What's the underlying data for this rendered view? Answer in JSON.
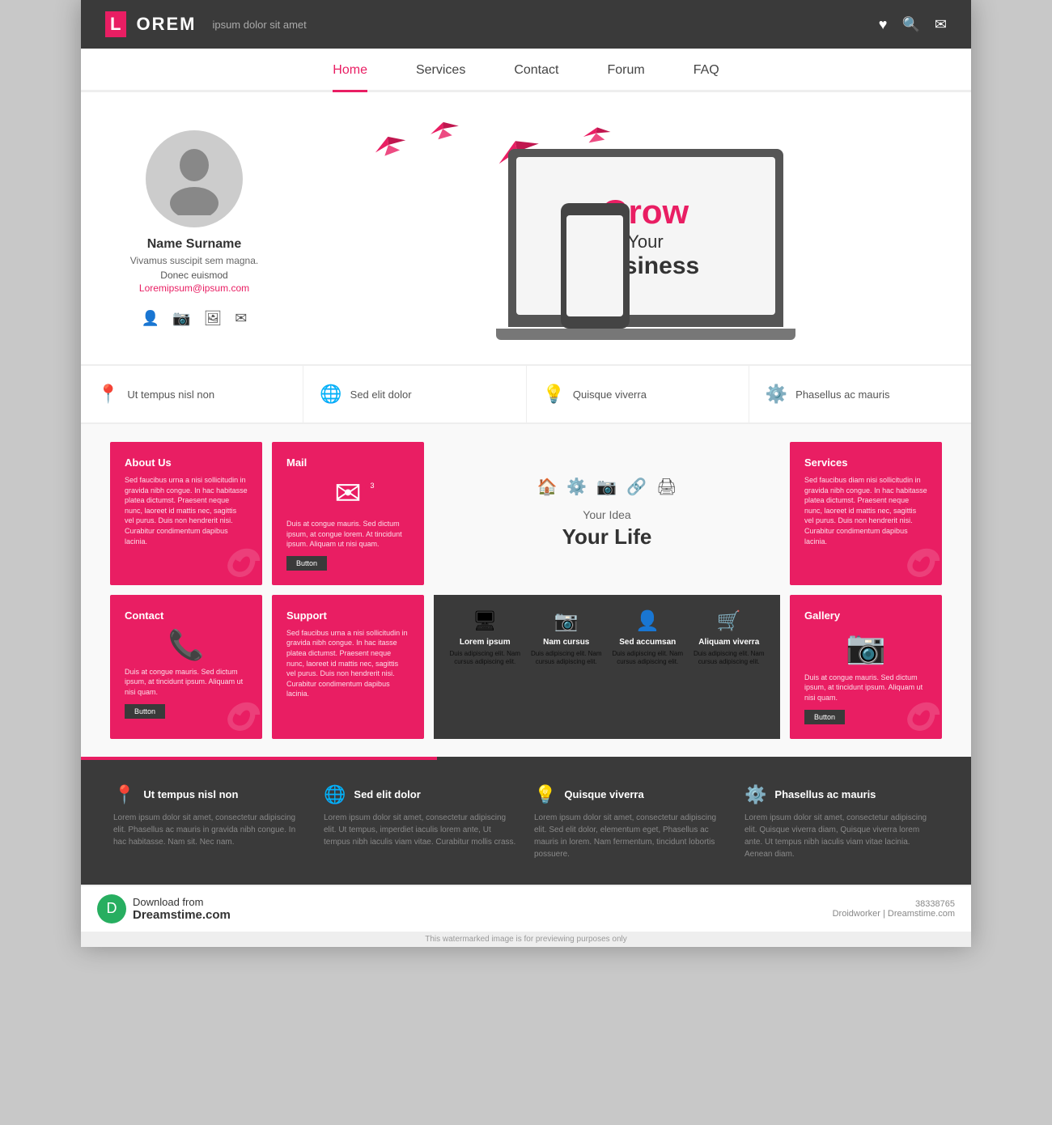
{
  "header": {
    "logo_accent": "L",
    "logo_rest": "OREM",
    "tagline": "ipsum dolor sit amet"
  },
  "nav": {
    "items": [
      {
        "label": "Home",
        "active": true
      },
      {
        "label": "Services",
        "active": false
      },
      {
        "label": "Contact",
        "active": false
      },
      {
        "label": "Forum",
        "active": false
      },
      {
        "label": "FAQ",
        "active": false
      }
    ]
  },
  "profile": {
    "name": "Name Surname",
    "desc": "Vivamus suscipit sem magna.",
    "sub": "Donec euismod",
    "email": "Loremipsum@ipsum.com"
  },
  "hero": {
    "grow": "Grow",
    "your": "Your",
    "business": "Business"
  },
  "features": [
    {
      "icon": "📍",
      "text": "Ut tempus nisl non"
    },
    {
      "icon": "🌐",
      "text": "Sed elit dolor"
    },
    {
      "icon": "💡",
      "text": "Quisque viverra"
    },
    {
      "icon": "⚙️",
      "text": "Phasellus ac mauris"
    }
  ],
  "cards": {
    "about": {
      "title": "About Us",
      "body": "Sed faucibus urna a nisi sollicitudin in gravida nibh congue. In hac habitasse platea dictumst. Praesent neque nunc, laoreet id mattis nec, sagittis vel purus. Duis non hendrerit nisi. Curabitur condimentum dapibus lacinia."
    },
    "mail": {
      "title": "Mail",
      "body": "Duis at congue mauris. Sed dictum ipsum, at congue lorem. At tincidunt ipsum. Aliquam ut nisi quam.",
      "badge": "3",
      "button": "Button"
    },
    "center": {
      "idea": "Your Idea",
      "life": "Your Life"
    },
    "services_card": {
      "title": "Services",
      "body": "Sed faucibus diam nisi sollicitudin in gravida nibh congue. In hac habitasse platea dictumst. Praesent neque nunc, laoreet id mattis nec, sagittis vel purus. Duis non hendrerit nisi. Curabitur condimentum dapibus lacinia."
    },
    "contact": {
      "title": "Contact",
      "body": "Duis at congue mauris. Sed dictum ipsum, at tincidunt ipsum. Aliquam ut nisi quam.",
      "button": "Button"
    },
    "support": {
      "title": "Support",
      "body": "Sed faucibus urna a nisi sollicitudin in gravida nibh congue. In hac itasse platea dictumst. Praesent neque nunc, laoreet id mattis nec, sagittis vel purus. Duis non hendrerit nisi. Curabitur condimentum dapibus lacinia."
    },
    "dark_services": {
      "cols": [
        {
          "icon": "🖥",
          "title": "Lorem ipsum",
          "body": "Duis adipiscing elit. Nam cursus adipiscing elit."
        },
        {
          "icon": "📷",
          "title": "Nam cursus",
          "body": "Duis adipiscing elit. Nam cursus adipiscing elit."
        },
        {
          "icon": "👤",
          "title": "Sed accumsan",
          "body": "Duis adipiscing elit. Nam cursus adipiscing elit."
        },
        {
          "icon": "🛒",
          "title": "Aliquam viverra",
          "body": "Duis adipiscing elit. Nam cursus adipiscing elit."
        }
      ]
    },
    "gallery": {
      "title": "Gallery",
      "body": "Duis at congue mauris. Sed dictum ipsum, at tincidunt ipsum. Aliquam ut nisi quam.",
      "button": "Button"
    }
  },
  "footer_features": [
    {
      "icon": "📍",
      "title": "Ut tempus nisl non",
      "body": "Lorem ipsum dolor sit amet, consectetur adipiscing elit. Phasellus ac mauris in gravida nibh congue. In hac habitasse. Nam sit. Nec nam."
    },
    {
      "icon": "🌐",
      "title": "Sed elit dolor",
      "body": "Lorem ipsum dolor sit amet, consectetur adipiscing elit. Ut tempus, imperdiet iaculis lorem ante, Ut tempus nibh iaculis viam vitae. Curabitur mollis crass."
    },
    {
      "icon": "💡",
      "title": "Quisque viverra",
      "body": "Lorem ipsum dolor sit amet, consectetur adipiscing elit. Sed elit dolor, elementum eget, Phasellus ac mauris in lorem. Nam fermentum, tincidunt lobortis possuere."
    },
    {
      "icon": "⚙️",
      "title": "Phasellus ac mauris",
      "body": "Lorem ipsum dolor sit amet, consectetur adipiscing elit. Quisque viverra diam, Quisque viverra lorem ante. Ut tempus nibh iaculis viam vitae lacinia. Aenean diam."
    }
  ],
  "dreamstime": {
    "download_text": "Download from",
    "site_name": "Dreamstime.com",
    "watermark": "This watermarked image is for previewing purposes only",
    "id": "38338765",
    "author": "Droidworker | Dreamstime.com"
  }
}
